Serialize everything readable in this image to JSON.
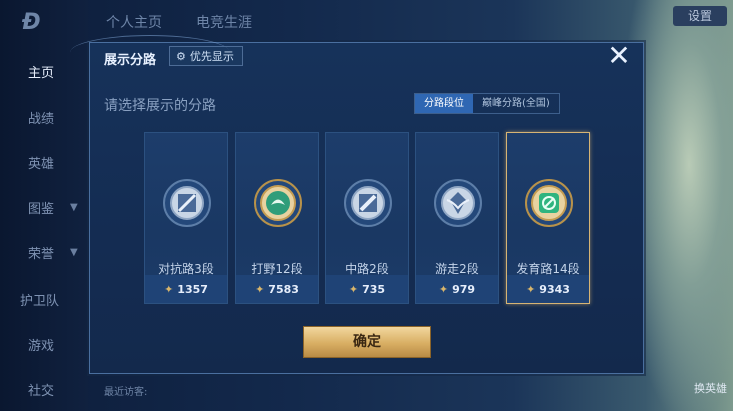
{
  "background": {
    "tabs": [
      "个人主页",
      "电竞生涯"
    ],
    "settings_label": "设置",
    "recent_visitors": "最近访客:",
    "swap_hero": "换英雄"
  },
  "sidebar": {
    "items": [
      {
        "label": "主页",
        "active": true
      },
      {
        "label": "战绩"
      },
      {
        "label": "英雄"
      },
      {
        "label": "图鉴"
      },
      {
        "label": "荣誉"
      },
      {
        "label": "护卫队"
      },
      {
        "label": "游戏"
      },
      {
        "label": "社交"
      }
    ]
  },
  "modal": {
    "title": "展示分路",
    "priority_label": "优先显示",
    "close_icon": "close-icon",
    "subtitle": "请选择展示的分路",
    "segments": [
      {
        "label": "分路段位",
        "active": true
      },
      {
        "label": "巅峰分路(全国)",
        "active": false
      }
    ],
    "cards": [
      {
        "name": "对抗路3段",
        "value": "1357",
        "emblem_color": "#9fb4cf",
        "selected": false
      },
      {
        "name": "打野12段",
        "value": "7583",
        "emblem_color": "#3fae8c",
        "selected": false
      },
      {
        "name": "中路2段",
        "value": "735",
        "emblem_color": "#9fb4cf",
        "selected": false
      },
      {
        "name": "游走2段",
        "value": "979",
        "emblem_color": "#9fb4cf",
        "selected": false
      },
      {
        "name": "发育路14段",
        "value": "9343",
        "emblem_color": "#2fb47f",
        "selected": true
      }
    ],
    "confirm_label": "确定"
  },
  "colors": {
    "accent_gold": "#d6b474",
    "segment_active": "#2f67b3"
  }
}
